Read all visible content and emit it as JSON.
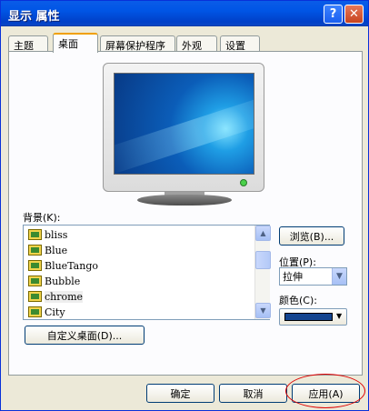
{
  "window": {
    "title": "显示 属性",
    "help_glyph": "?",
    "close_glyph": "✕"
  },
  "tabs": [
    {
      "label": "主题"
    },
    {
      "label": "桌面"
    },
    {
      "label": "屏幕保护程序"
    },
    {
      "label": "外观"
    },
    {
      "label": "设置"
    }
  ],
  "background": {
    "label": "背景",
    "accel": "(K):",
    "items": [
      {
        "label": "bliss"
      },
      {
        "label": "Blue"
      },
      {
        "label": "BlueTango"
      },
      {
        "label": "Bubble"
      },
      {
        "label": "chrome"
      },
      {
        "label": "City"
      }
    ]
  },
  "browse_button": "浏览(B)...",
  "position": {
    "label": "位置",
    "accel": "(P):",
    "value": "拉伸"
  },
  "color": {
    "label": "颜色",
    "accel": "(C):",
    "swatch": "#15458f"
  },
  "customize_button": "自定义桌面(D)...",
  "footer": {
    "ok": "确定",
    "cancel": "取消",
    "apply": "应用(A)"
  }
}
